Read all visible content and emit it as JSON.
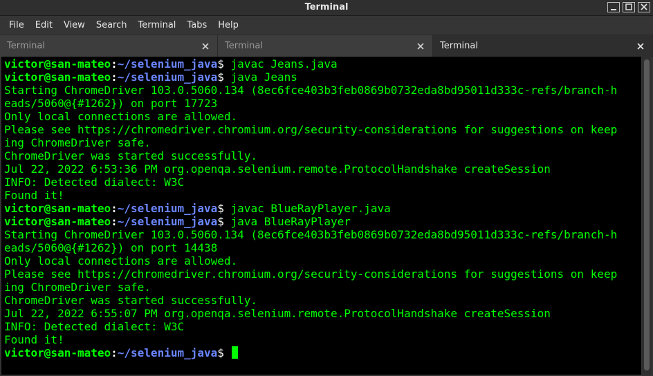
{
  "window": {
    "title": "Terminal"
  },
  "menubar": {
    "items": [
      "File",
      "Edit",
      "View",
      "Search",
      "Terminal",
      "Tabs",
      "Help"
    ]
  },
  "tabs": [
    {
      "label": "Terminal",
      "active": false
    },
    {
      "label": "Terminal",
      "active": false
    },
    {
      "label": "Terminal",
      "active": true
    }
  ],
  "prompt": {
    "user_host": "victor@san-mateo",
    "separator": ":",
    "path": "~/selenium_java",
    "symbol": "$"
  },
  "terminal_lines": [
    {
      "type": "prompt",
      "command": " javac Jeans.java"
    },
    {
      "type": "prompt",
      "command": " java Jeans"
    },
    {
      "type": "output",
      "text": "Starting ChromeDriver 103.0.5060.134 (8ec6fce403b3feb0869b0732eda8bd95011d333c-refs/branch-h"
    },
    {
      "type": "output",
      "text": "eads/5060@{#1262}) on port 17723"
    },
    {
      "type": "output",
      "text": "Only local connections are allowed."
    },
    {
      "type": "output",
      "text": "Please see https://chromedriver.chromium.org/security-considerations for suggestions on keep"
    },
    {
      "type": "output",
      "text": "ing ChromeDriver safe."
    },
    {
      "type": "output",
      "text": "ChromeDriver was started successfully."
    },
    {
      "type": "output",
      "text": "Jul 22, 2022 6:53:36 PM org.openqa.selenium.remote.ProtocolHandshake createSession"
    },
    {
      "type": "output",
      "text": "INFO: Detected dialect: W3C"
    },
    {
      "type": "output",
      "text": "Found it!"
    },
    {
      "type": "prompt",
      "command": " javac BlueRayPlayer.java"
    },
    {
      "type": "prompt",
      "command": " java BlueRayPlayer"
    },
    {
      "type": "output",
      "text": "Starting ChromeDriver 103.0.5060.134 (8ec6fce403b3feb0869b0732eda8bd95011d333c-refs/branch-h"
    },
    {
      "type": "output",
      "text": "eads/5060@{#1262}) on port 14438"
    },
    {
      "type": "output",
      "text": "Only local connections are allowed."
    },
    {
      "type": "output",
      "text": "Please see https://chromedriver.chromium.org/security-considerations for suggestions on keep"
    },
    {
      "type": "output",
      "text": "ing ChromeDriver safe."
    },
    {
      "type": "output",
      "text": "ChromeDriver was started successfully."
    },
    {
      "type": "output",
      "text": "Jul 22, 2022 6:55:07 PM org.openqa.selenium.remote.ProtocolHandshake createSession"
    },
    {
      "type": "output",
      "text": "INFO: Detected dialect: W3C"
    },
    {
      "type": "output",
      "text": "Found it!"
    },
    {
      "type": "prompt",
      "command": " ",
      "cursor": true
    }
  ],
  "colors": {
    "output_green": "#00ff00",
    "path_blue": "#6b86ff",
    "background": "#000000"
  },
  "icons": {
    "minimize": "minimize-icon",
    "maximize": "maximize-icon",
    "close": "close-icon",
    "tab_close": "tab-close-icon"
  }
}
